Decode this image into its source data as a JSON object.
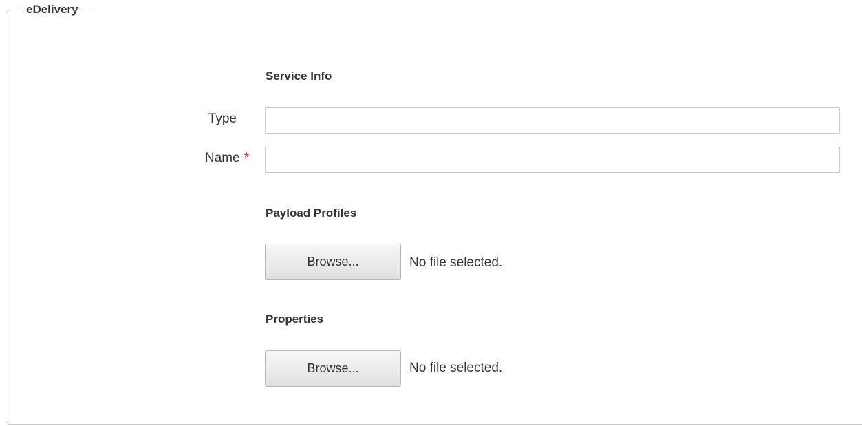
{
  "fieldset": {
    "legend": "eDelivery"
  },
  "service_info": {
    "title": "Service Info",
    "type_label": "Type",
    "type_value": "",
    "name_label": "Name",
    "name_required_marker": "*",
    "name_value": ""
  },
  "payload_profiles": {
    "title": "Payload Profiles",
    "browse_label": "Browse...",
    "file_status": "No file selected."
  },
  "properties": {
    "title": "Properties",
    "browse_label": "Browse...",
    "file_status": "No file selected."
  },
  "colors": {
    "border": "#c9c9c9",
    "text": "#333333",
    "required": "#e3262c"
  }
}
